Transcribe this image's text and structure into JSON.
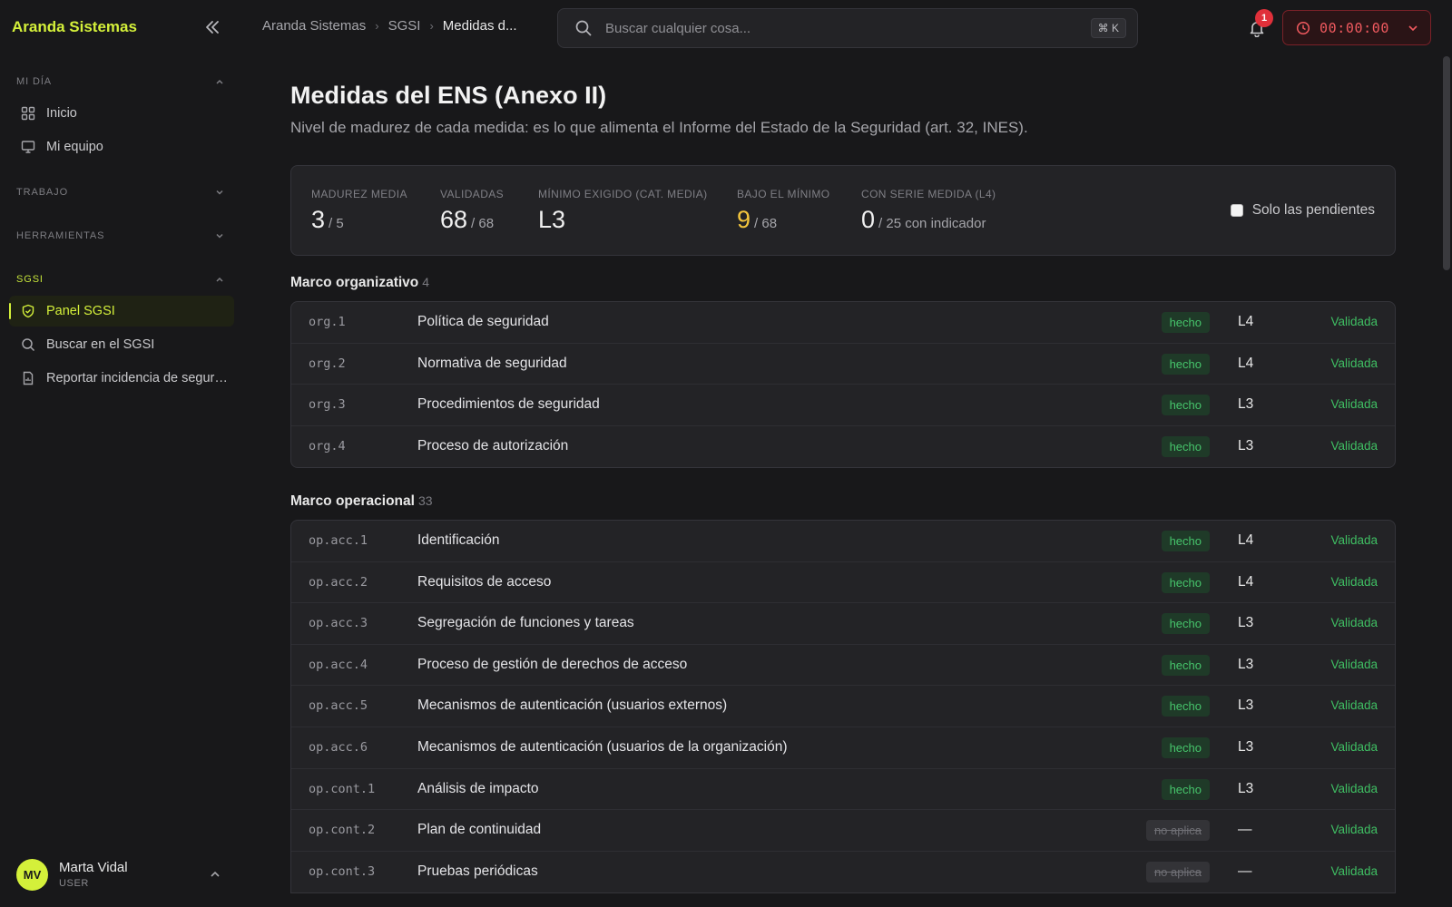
{
  "sidebar": {
    "brand": "Aranda Sistemas",
    "sections": {
      "mi_dia": "MI DÍA",
      "trabajo": "TRABAJO",
      "herramientas": "HERRAMIENTAS",
      "sgsi": "SGSI"
    },
    "items": {
      "inicio": "Inicio",
      "mi_equipo": "Mi equipo",
      "panel_sgsi": "Panel SGSI",
      "buscar_sgsi": "Buscar en el SGSI",
      "reportar": "Reportar incidencia de seguri..."
    },
    "user": {
      "initials": "MV",
      "name": "Marta Vidal",
      "role": "USER"
    }
  },
  "header": {
    "breadcrumb": [
      "Aranda Sistemas",
      "SGSI",
      "Medidas d..."
    ],
    "search_placeholder": "Buscar cualquier cosa...",
    "search_shortcut": "⌘ K",
    "notifications": "1",
    "timer": "00:00:00"
  },
  "page": {
    "title": "Medidas del ENS (Anexo II)",
    "subtitle": "Nivel de madurez de cada medida: es lo que alimenta el Informe del Estado de la Seguridad (art. 32, INES)."
  },
  "stats": {
    "madurez": {
      "label": "MADUREZ MEDIA",
      "value": "3",
      "suffix": "/ 5"
    },
    "validadas": {
      "label": "VALIDADAS",
      "value": "68",
      "suffix": "/ 68"
    },
    "minimo": {
      "label": "MÍNIMO EXIGIDO (CAT. MEDIA)",
      "value": "L3",
      "suffix": ""
    },
    "bajo": {
      "label": "BAJO EL MÍNIMO",
      "value": "9",
      "suffix": "/ 68"
    },
    "serie": {
      "label": "CON SERIE MEDIDA (L4)",
      "value": "0",
      "suffix": "/ 25 con indicador"
    },
    "pending_toggle": "Solo las pendientes"
  },
  "groups": {
    "org": {
      "title": "Marco organizativo",
      "count": "4",
      "rows": [
        {
          "code": "org.1",
          "name": "Política de seguridad",
          "badge": "hecho",
          "level": "L4",
          "status": "Validada"
        },
        {
          "code": "org.2",
          "name": "Normativa de seguridad",
          "badge": "hecho",
          "level": "L4",
          "status": "Validada"
        },
        {
          "code": "org.3",
          "name": "Procedimientos de seguridad",
          "badge": "hecho",
          "level": "L3",
          "status": "Validada"
        },
        {
          "code": "org.4",
          "name": "Proceso de autorización",
          "badge": "hecho",
          "level": "L3",
          "status": "Validada"
        }
      ]
    },
    "op": {
      "title": "Marco operacional",
      "count": "33",
      "rows": [
        {
          "code": "op.acc.1",
          "name": "Identificación",
          "badge": "hecho",
          "level": "L4",
          "status": "Validada"
        },
        {
          "code": "op.acc.2",
          "name": "Requisitos de acceso",
          "badge": "hecho",
          "level": "L4",
          "status": "Validada"
        },
        {
          "code": "op.acc.3",
          "name": "Segregación de funciones y tareas",
          "badge": "hecho",
          "level": "L3",
          "status": "Validada"
        },
        {
          "code": "op.acc.4",
          "name": "Proceso de gestión de derechos de acceso",
          "badge": "hecho",
          "level": "L3",
          "status": "Validada"
        },
        {
          "code": "op.acc.5",
          "name": "Mecanismos de autenticación (usuarios externos)",
          "badge": "hecho",
          "level": "L3",
          "status": "Validada"
        },
        {
          "code": "op.acc.6",
          "name": "Mecanismos de autenticación (usuarios de la organización)",
          "badge": "hecho",
          "level": "L3",
          "status": "Validada"
        },
        {
          "code": "op.cont.1",
          "name": "Análisis de impacto",
          "badge": "hecho",
          "level": "L3",
          "status": "Validada"
        },
        {
          "code": "op.cont.2",
          "name": "Plan de continuidad",
          "badge": "no aplica",
          "level": "—",
          "status": "Validada"
        },
        {
          "code": "op.cont.3",
          "name": "Pruebas periódicas",
          "badge": "no aplica",
          "level": "—",
          "status": "Validada"
        }
      ]
    }
  }
}
